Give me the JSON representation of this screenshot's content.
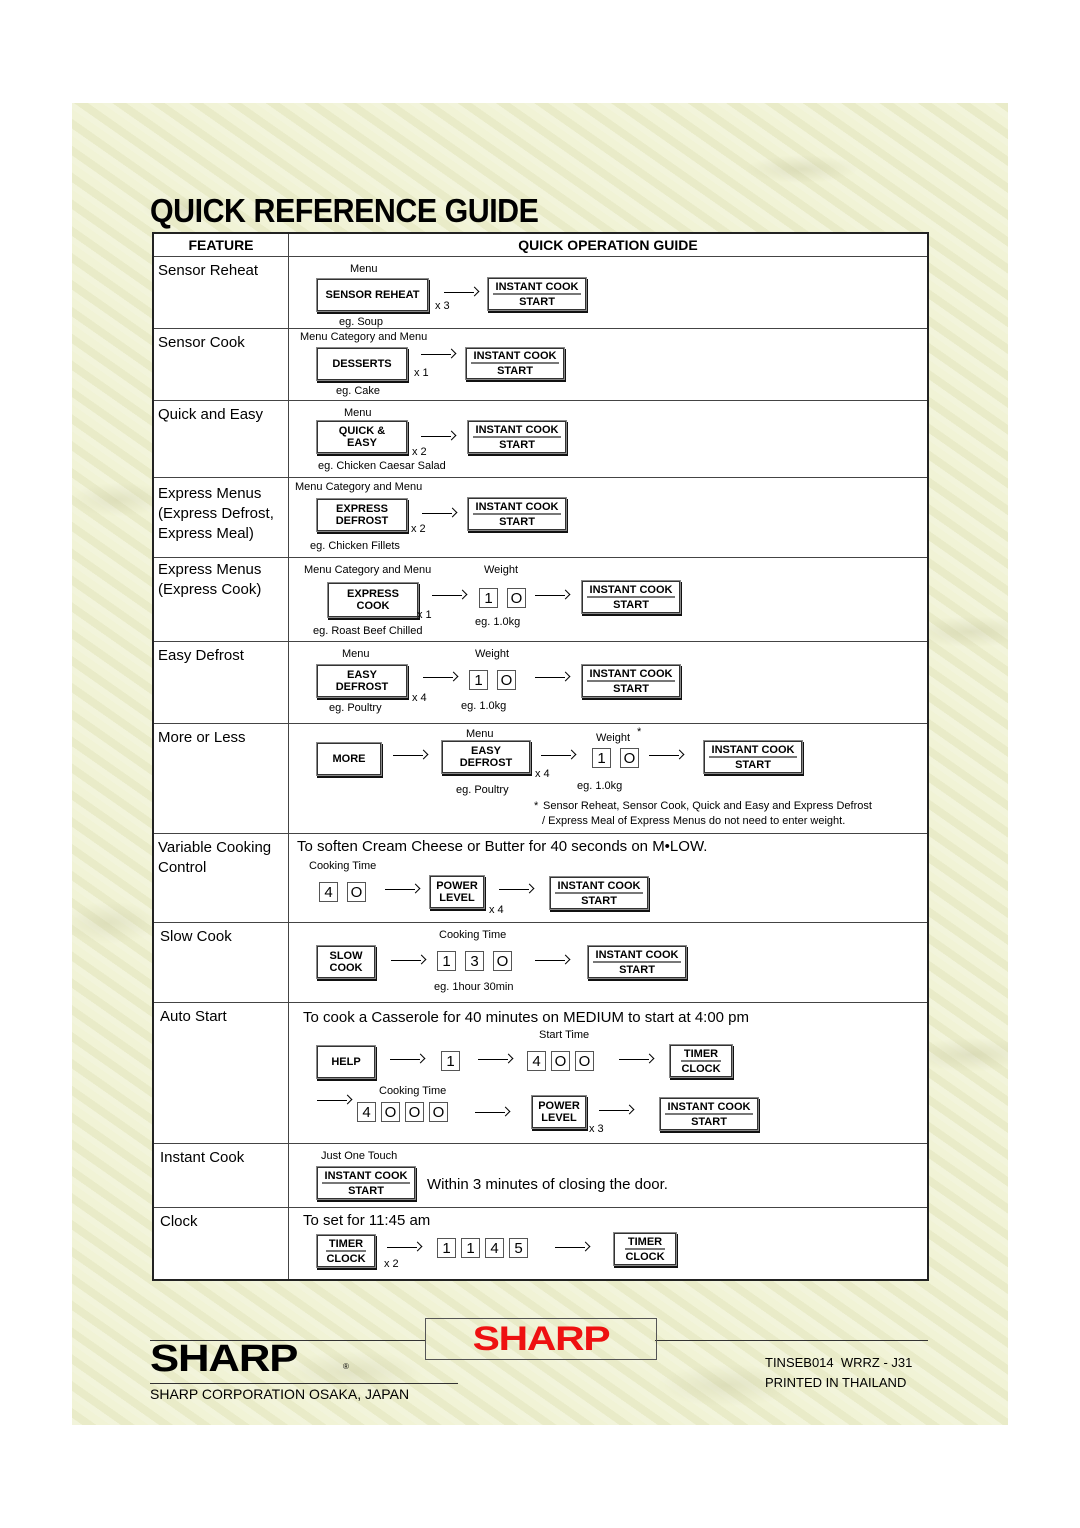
{
  "title": "QUICK REFERENCE GUIDE",
  "headers": {
    "feature": "FEATURE",
    "operation": "QUICK OPERATION GUIDE"
  },
  "rows": {
    "sensor_reheat": {
      "feature": "Sensor Reheat",
      "caption_top": "Menu",
      "button": "SENSOR REHEAT",
      "mult": "x 3",
      "example": "eg. Soup",
      "start_top": "INSTANT COOK",
      "start_bot": "START"
    },
    "sensor_cook": {
      "feature": "Sensor Cook",
      "caption_top": "Menu Category and Menu",
      "button": "DESSERTS",
      "mult": "x 1",
      "example": "eg. Cake",
      "start_top": "INSTANT COOK",
      "start_bot": "START"
    },
    "quick_easy": {
      "feature": "Quick and Easy",
      "caption_top": "Menu",
      "button_top": "QUICK &",
      "button_bot": "EASY",
      "mult": "x 2",
      "example": "eg. Chicken Caesar Salad",
      "start_top": "INSTANT COOK",
      "start_bot": "START"
    },
    "express_defrost": {
      "feature_lines": [
        "Express Menus",
        "(Express Defrost,",
        "Express Meal)"
      ],
      "caption_top": "Menu Category and Menu",
      "button_top": "EXPRESS",
      "button_bot": "DEFROST",
      "mult": "x 2",
      "example": "eg. Chicken Fillets",
      "start_top": "INSTANT COOK",
      "start_bot": "START"
    },
    "express_cook": {
      "feature_lines": [
        "Express Menus",
        "(Express Cook)"
      ],
      "caption_top": "Menu Category and Menu",
      "weight_caption": "Weight",
      "button_top": "EXPRESS",
      "button_bot": "COOK",
      "mult": "x 1",
      "example": "eg. Roast Beef Chilled",
      "keys": [
        "1",
        "O"
      ],
      "weight_example": "eg. 1.0kg",
      "start_top": "INSTANT COOK",
      "start_bot": "START"
    },
    "easy_defrost": {
      "feature": "Easy Defrost",
      "caption_top": "Menu",
      "weight_caption": "Weight",
      "button_top": "EASY",
      "button_bot": "DEFROST",
      "mult": "x 4",
      "example": "eg. Poultry",
      "keys": [
        "1",
        "O"
      ],
      "weight_example": "eg. 1.0kg",
      "start_top": "INSTANT COOK",
      "start_bot": "START"
    },
    "more_less": {
      "feature": "More or Less",
      "more_button": "MORE",
      "caption_top": "Menu",
      "weight_caption": "Weight",
      "star": "*",
      "button_top": "EASY",
      "button_bot": "DEFROST",
      "mult": "x 4",
      "example": "eg. Poultry",
      "keys": [
        "1",
        "O"
      ],
      "weight_example": "eg. 1.0kg",
      "start_top": "INSTANT COOK",
      "start_bot": "START",
      "note_line1": "Sensor Reheat, Sensor Cook, Quick and Easy and Express Defrost",
      "note_line2": "/ Express Meal of Express Menus do not need to enter weight."
    },
    "variable_cooking": {
      "feature_lines": [
        "Variable Cooking",
        "Control"
      ],
      "instruction": "To soften Cream Cheese or Butter for 40 seconds on M•LOW.",
      "time_caption": "Cooking Time",
      "keys": [
        "4",
        "O"
      ],
      "button_top": "POWER",
      "button_bot": "LEVEL",
      "mult": "x 4",
      "start_top": "INSTANT COOK",
      "start_bot": "START"
    },
    "slow_cook": {
      "feature": "Slow Cook",
      "time_caption": "Cooking Time",
      "button_top": "SLOW",
      "button_bot": "COOK",
      "keys": [
        "1",
        "3",
        "O"
      ],
      "example": "eg. 1hour 30min",
      "start_top": "INSTANT COOK",
      "start_bot": "START"
    },
    "auto_start": {
      "feature": "Auto Start",
      "instruction": "To cook a Casserole for 40 minutes on MEDIUM to start at 4:00 pm",
      "help_button": "HELP",
      "key_help": "1",
      "start_time_caption": "Start Time",
      "start_keys": [
        "4",
        "O",
        "O"
      ],
      "timer_top": "TIMER",
      "timer_bot": "CLOCK",
      "time_caption": "Cooking Time",
      "cook_keys": [
        "4",
        "O",
        "O",
        "O"
      ],
      "power_top": "POWER",
      "power_bot": "LEVEL",
      "mult": "x 3",
      "start_top": "INSTANT COOK",
      "start_bot": "START"
    },
    "instant_cook": {
      "feature": "Instant Cook",
      "caption_top": "Just One Touch",
      "start_top": "INSTANT COOK",
      "start_bot": "START",
      "note": "Within 3 minutes of closing the door."
    },
    "clock": {
      "feature": "Clock",
      "instruction": "To set for 11:45 am",
      "timer_top": "TIMER",
      "timer_bot": "CLOCK",
      "mult": "x 2",
      "keys": [
        "1",
        "1",
        "4",
        "5"
      ]
    }
  },
  "footer": {
    "brand": "SHARP",
    "registered": "®",
    "brand_center": "SHARP",
    "corporation": "SHARP CORPORATION OSAKA, JAPAN",
    "code": "TINSEB014  WRRZ - J31",
    "printed": "PRINTED IN THAILAND",
    "brand_red": "#ee1111"
  }
}
